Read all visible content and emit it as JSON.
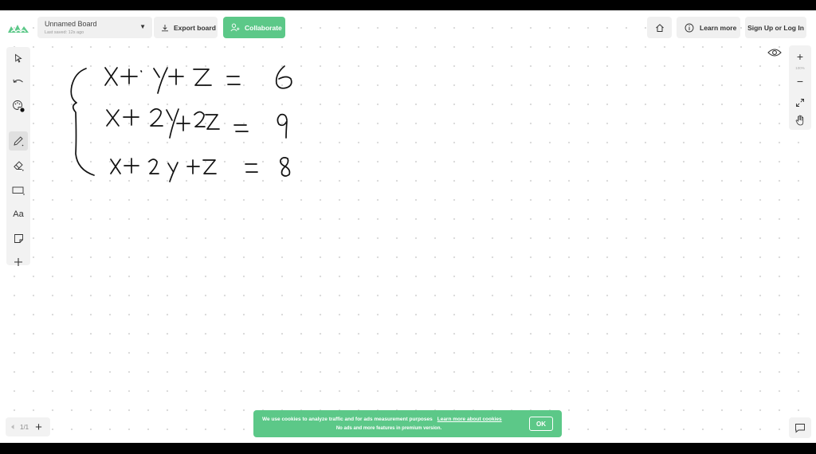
{
  "header": {
    "board_name": "Unnamed Board",
    "last_saved": "Last saved: 12s ago",
    "export_label": "Export board",
    "collaborate_label": "Collaborate",
    "learn_more_label": "Learn more",
    "signup_label": "Sign Up or Log In"
  },
  "left_toolbar": {
    "tools": [
      "select-icon",
      "undo-icon",
      "palette-icon",
      "pen-icon",
      "eraser-icon",
      "rectangle-icon",
      "text-tool",
      "sticky-note-icon",
      "add-icon"
    ],
    "active": "pen-icon",
    "text_tool_label": "Aa"
  },
  "right_toolbar": {
    "zoom_in": "+",
    "zoom_level": "100%",
    "zoom_out": "−",
    "tools": [
      "zoom-in-icon",
      "zoom-out-icon",
      "fit-screen-icon",
      "pan-hand-icon"
    ]
  },
  "pages": {
    "current": "1/1",
    "add": "+"
  },
  "cookie_banner": {
    "message": "We use cookies to analyze traffic and for ads measurement purposes",
    "link_text": "Learn more about cookies",
    "sub_message": "No ads and more features in premium version.",
    "ok_label": "OK"
  },
  "colors": {
    "accent_green": "#5cc888",
    "toolbar_bg": "#f2f2f2",
    "ink": "#111111"
  }
}
